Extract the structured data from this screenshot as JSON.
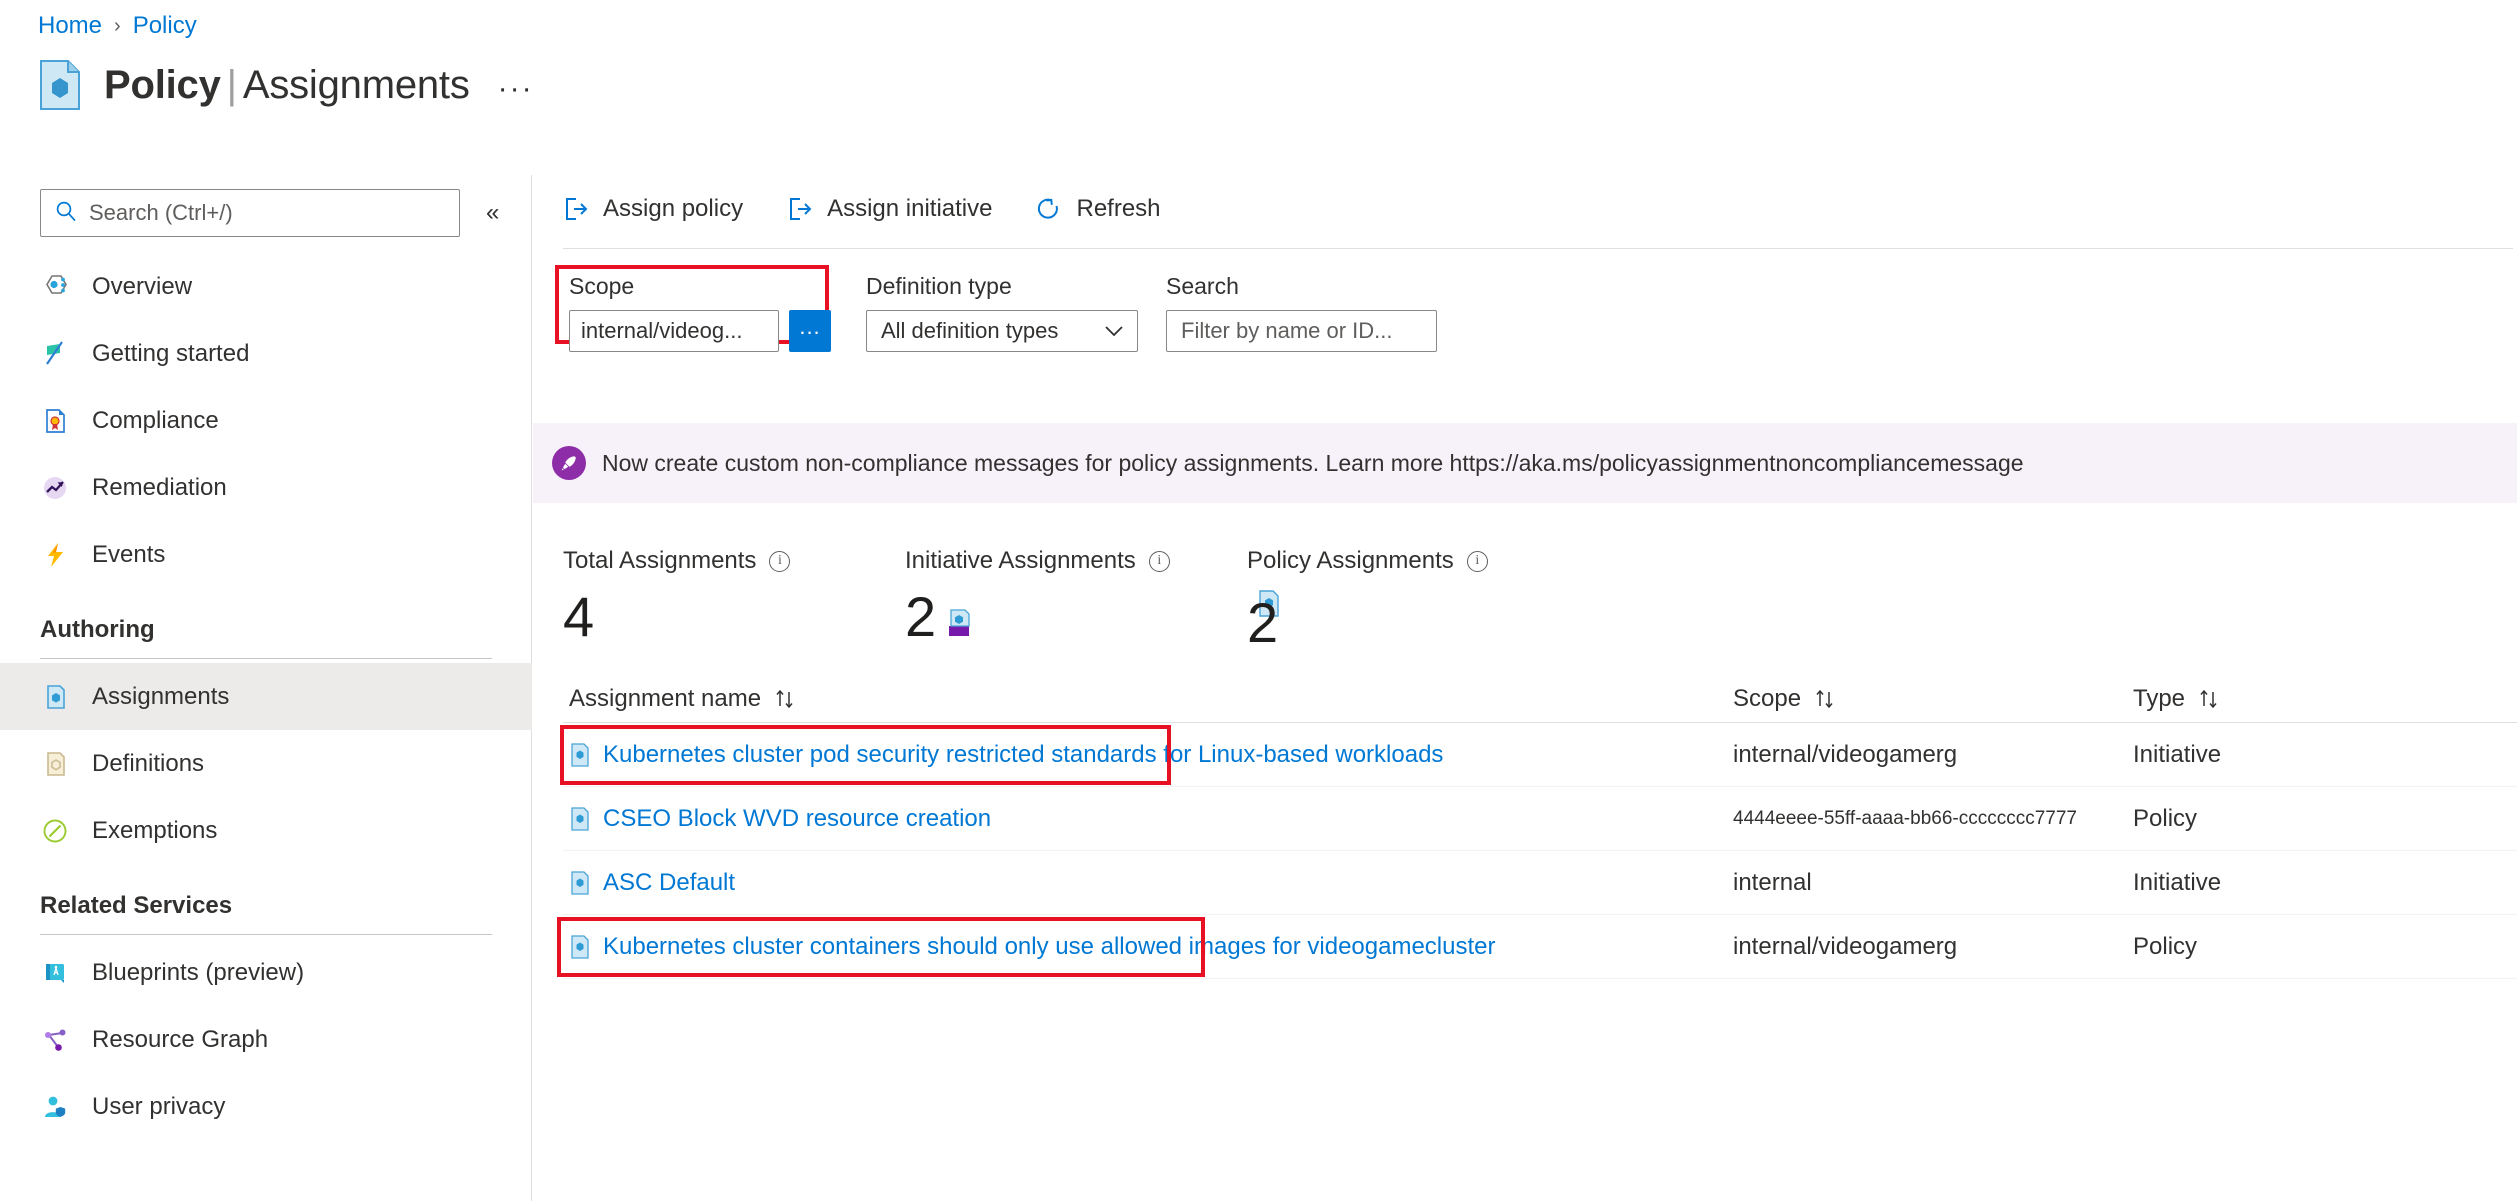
{
  "breadcrumb": {
    "home": "Home",
    "separator": "›",
    "current": "Policy"
  },
  "header": {
    "title_bold": "Policy",
    "title_bar": "|",
    "title_rest": "Assignments",
    "ellipsis": "···",
    "icon": "policy-document-icon"
  },
  "sidebar": {
    "search_placeholder": "Search (Ctrl+/)",
    "collapse_label": "«",
    "items": [
      {
        "label": "Overview",
        "icon": "policy-overview-icon",
        "selected": false
      },
      {
        "label": "Getting started",
        "icon": "flag-icon",
        "selected": false
      },
      {
        "label": "Compliance",
        "icon": "compliance-certificate-icon",
        "selected": false
      },
      {
        "label": "Remediation",
        "icon": "remediation-trend-icon",
        "selected": false
      },
      {
        "label": "Events",
        "icon": "lightning-bolt-icon",
        "selected": false
      }
    ],
    "section_authoring": "Authoring",
    "authoring_items": [
      {
        "label": "Assignments",
        "icon": "assignment-document-icon",
        "selected": true
      },
      {
        "label": "Definitions",
        "icon": "definition-document-icon",
        "selected": false
      },
      {
        "label": "Exemptions",
        "icon": "exemption-slash-icon",
        "selected": false
      }
    ],
    "section_related": "Related Services",
    "related_items": [
      {
        "label": "Blueprints (preview)",
        "icon": "blueprint-icon",
        "selected": false
      },
      {
        "label": "Resource Graph",
        "icon": "resource-graph-icon",
        "selected": false
      },
      {
        "label": "User privacy",
        "icon": "user-privacy-icon",
        "selected": false
      }
    ]
  },
  "toolbar": {
    "assign_policy": "Assign policy",
    "assign_initiative": "Assign initiative",
    "refresh": "Refresh"
  },
  "filters": {
    "scope_label": "Scope",
    "scope_value": "internal/videog...",
    "scope_browse": "...",
    "definition_type_label": "Definition type",
    "definition_type_value": "All definition types",
    "search_label": "Search",
    "search_placeholder": "Filter by name or ID..."
  },
  "banner": {
    "icon": "rocket-icon",
    "text": "Now create custom non-compliance messages for policy assignments. Learn more https://aka.ms/policyassignmentnoncompliancemessage"
  },
  "stats": [
    {
      "label": "Total Assignments",
      "value": "4",
      "badge": "none"
    },
    {
      "label": "Initiative Assignments",
      "value": "2",
      "badge": "initiative-icon"
    },
    {
      "label": "Policy Assignments",
      "value": "2",
      "badge": "policy-icon"
    }
  ],
  "table": {
    "columns": [
      {
        "label": "Assignment name",
        "sort": "↑↓"
      },
      {
        "label": "Scope",
        "sort": "↑↓"
      },
      {
        "label": "Type",
        "sort": "↑↓"
      }
    ],
    "rows": [
      {
        "name": "Kubernetes cluster pod security restricted standards for Linux-based workloads",
        "scope": "internal/videogamerg",
        "type": "Initiative",
        "highlighted": true,
        "scope_small": false
      },
      {
        "name": "CSEO Block WVD resource creation",
        "scope": "4444eeee-55ff-aaaa-bb66-cccccccc7777",
        "type": "Policy",
        "highlighted": false,
        "scope_small": true
      },
      {
        "name": "ASC Default",
        "scope": "internal",
        "type": "Initiative",
        "highlighted": false,
        "scope_small": false
      },
      {
        "name": "Kubernetes cluster containers should only use allowed images for videogamecluster",
        "scope": "internal/videogamerg",
        "type": "Policy",
        "highlighted": true,
        "scope_small": false
      }
    ]
  },
  "colors": {
    "accent": "#0078d4",
    "highlight": "#e81123",
    "banner_bg": "#f7f2fa",
    "banner_icon": "#8e2da8",
    "selected_nav": "#edebe9"
  }
}
